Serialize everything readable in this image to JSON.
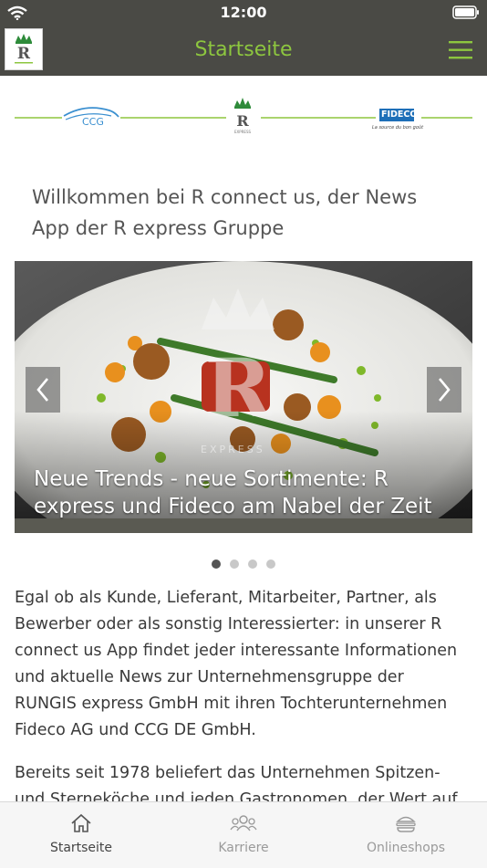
{
  "status_bar": {
    "time": "12:00"
  },
  "nav": {
    "title": "Startseite",
    "accent_color": "#8dc63f",
    "menu_icon": "hamburger-menu-icon"
  },
  "brands": {
    "ccg_label": "CCG",
    "fideco_label": "FIDECO",
    "fideco_tagline": "La source du bon goût"
  },
  "welcome": {
    "heading": "Willkommen bei R connect us, der News App der R express Gruppe"
  },
  "slider": {
    "caption": "Neue Trends - neue Sortimente: R express und Fideco am Nabel der Zeit",
    "watermark": "EXPRESS",
    "slide_count": 4,
    "active_index": 0
  },
  "body": {
    "paragraph1": "Egal ob als Kunde, Lieferant, Mitarbeiter, Partner, als Bewerber oder als sonstig Interessierter: in unserer R connect us App findet jeder interessante Informationen und aktuelle News zur Unternehmensgruppe der RUNGIS express GmbH mit ihren Tochterunternehmen Fideco AG und CCG DE GmbH.",
    "paragraph2": "Bereits seit 1978 beliefert das Unternehmen Spitzen- und Sterneköche und jeden Gastronomen, der Wert auf"
  },
  "tabs": [
    {
      "label": "Startseite",
      "icon": "home-icon",
      "active": true
    },
    {
      "label": "Karriere",
      "icon": "team-icon",
      "active": false
    },
    {
      "label": "Onlineshops",
      "icon": "burger-icon",
      "active": false
    }
  ]
}
